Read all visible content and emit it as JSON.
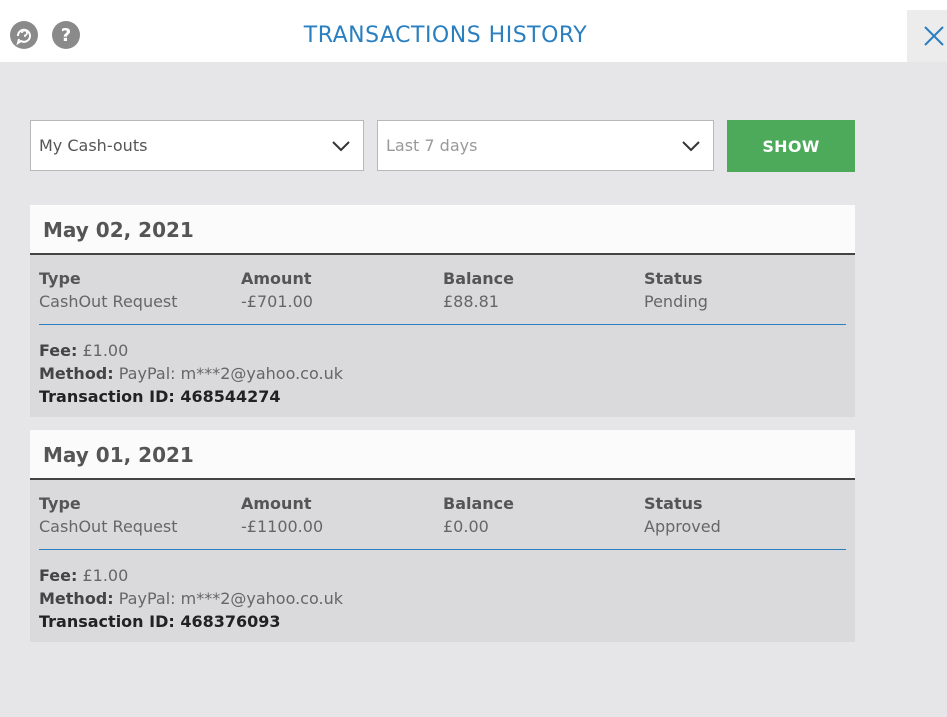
{
  "header": {
    "title": "TRANSACTIONS HISTORY",
    "help_glyph": "?",
    "icons": [
      "chat-support-icon",
      "help-icon",
      "close-icon"
    ]
  },
  "filters": {
    "type_selected": "My Cash-outs",
    "range_selected": "Last 7 days",
    "show_label": "SHOW",
    "show_color": "#4caa5a"
  },
  "columns": {
    "type": "Type",
    "amount": "Amount",
    "balance": "Balance",
    "status": "Status"
  },
  "labels": {
    "fee": "Fee:",
    "method": "Method:",
    "transaction_id": "Transaction ID:"
  },
  "transactions": [
    {
      "date": "May 02, 2021",
      "type": "CashOut Request",
      "amount": "-£701.00",
      "balance": "£88.81",
      "status": "Pending",
      "fee": "£1.00",
      "method": "PayPal: m***2@yahoo.co.uk",
      "transaction_id": "468544274"
    },
    {
      "date": "May 01, 2021",
      "type": "CashOut Request",
      "amount": "-£1100.00",
      "balance": "£0.00",
      "status": "Approved",
      "fee": "£1.00",
      "method": "PayPal: m***2@yahoo.co.uk",
      "transaction_id": "468376093"
    }
  ],
  "colors": {
    "accent": "#2a7fc0",
    "background": "#e6e6e8"
  }
}
